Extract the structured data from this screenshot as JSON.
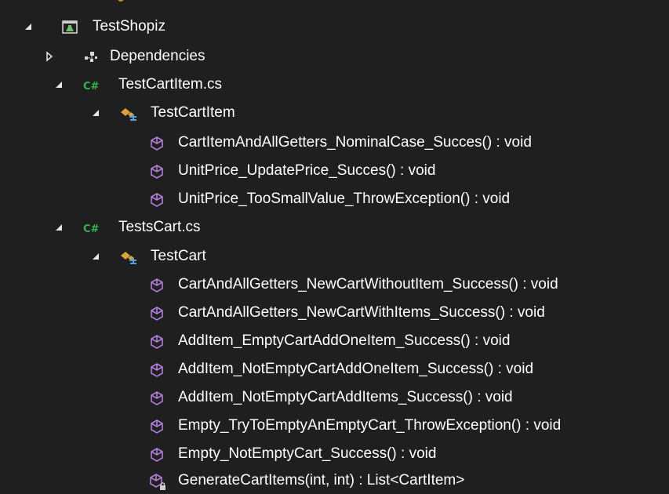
{
  "tree": {
    "root": {
      "label": "TestShopiz",
      "icon": "test-project-icon",
      "expanded": true
    },
    "dependencies": {
      "label": "Dependencies",
      "icon": "dependencies-icon",
      "expanded": false
    },
    "files": [
      {
        "label": "TestCartItem.cs",
        "icon": "csharp-file-icon",
        "expanded": true,
        "class": {
          "label": "TestCartItem",
          "icon": "class-icon",
          "expanded": true,
          "methods": [
            {
              "label": "CartItemAndAllGetters_NominalCase_Succes() : void",
              "icon": "method-icon"
            },
            {
              "label": "UnitPrice_UpdatePrice_Succes() : void",
              "icon": "method-icon"
            },
            {
              "label": "UnitPrice_TooSmallValue_ThrowException() : void",
              "icon": "method-icon"
            }
          ]
        }
      },
      {
        "label": "TestsCart.cs",
        "icon": "csharp-file-icon",
        "expanded": true,
        "class": {
          "label": "TestCart",
          "icon": "class-icon",
          "expanded": true,
          "methods": [
            {
              "label": "CartAndAllGetters_NewCartWithoutItem_Success() : void",
              "icon": "method-icon"
            },
            {
              "label": "CartAndAllGetters_NewCartWithItems_Success() : void",
              "icon": "method-icon"
            },
            {
              "label": "AddItem_EmptyCartAddOneItem_Success() : void",
              "icon": "method-icon"
            },
            {
              "label": "AddItem_NotEmptyCartAddOneItem_Success() : void",
              "icon": "method-icon"
            },
            {
              "label": "AddItem_NotEmptyCartAddItems_Success() : void",
              "icon": "method-icon"
            },
            {
              "label": "Empty_TryToEmptyAnEmptyCart_ThrowException() : void",
              "icon": "method-icon"
            },
            {
              "label": "Empty_NotEmptyCart_Success() : void",
              "icon": "method-icon"
            },
            {
              "label": "GenerateCartItems(int, int) : List<CartItem>",
              "icon": "private-method-icon"
            }
          ]
        }
      }
    ],
    "csharp_badge": "C#"
  },
  "colors": {
    "background": "#1f1f1f",
    "text": "#ffffff",
    "csharp": "#36b34f",
    "class": "#d9a43c",
    "method": "#b180d7",
    "project": "#6cc070"
  }
}
